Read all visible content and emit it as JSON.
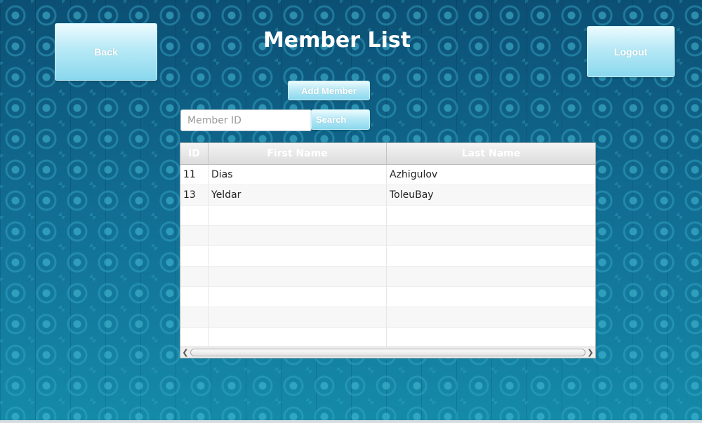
{
  "header": {
    "title": "Member List",
    "back_label": "Back",
    "logout_label": "Logout"
  },
  "actions": {
    "add_member_label": "Add Member",
    "search_label": "Search"
  },
  "search": {
    "placeholder": "Member ID",
    "value": ""
  },
  "table": {
    "columns": [
      "ID",
      "First Name",
      "Last Name"
    ],
    "rows": [
      {
        "id": "11",
        "first": "Dias",
        "last": "Azhigulov"
      },
      {
        "id": "13",
        "first": "Yeldar",
        "last": "ToleuBay"
      },
      {
        "id": "",
        "first": "",
        "last": ""
      },
      {
        "id": "",
        "first": "",
        "last": ""
      },
      {
        "id": "",
        "first": "",
        "last": ""
      },
      {
        "id": "",
        "first": "",
        "last": ""
      },
      {
        "id": "",
        "first": "",
        "last": ""
      },
      {
        "id": "",
        "first": "",
        "last": ""
      },
      {
        "id": "",
        "first": "",
        "last": ""
      }
    ]
  },
  "icons": {
    "scroll_left": "chevron-left-icon",
    "scroll_right": "chevron-right-icon"
  },
  "colors": {
    "background": "#0f5f86",
    "button_gradient_top": "#ecfbff",
    "button_gradient_bottom": "#8ad8ee",
    "title_text": "#ffffff"
  }
}
